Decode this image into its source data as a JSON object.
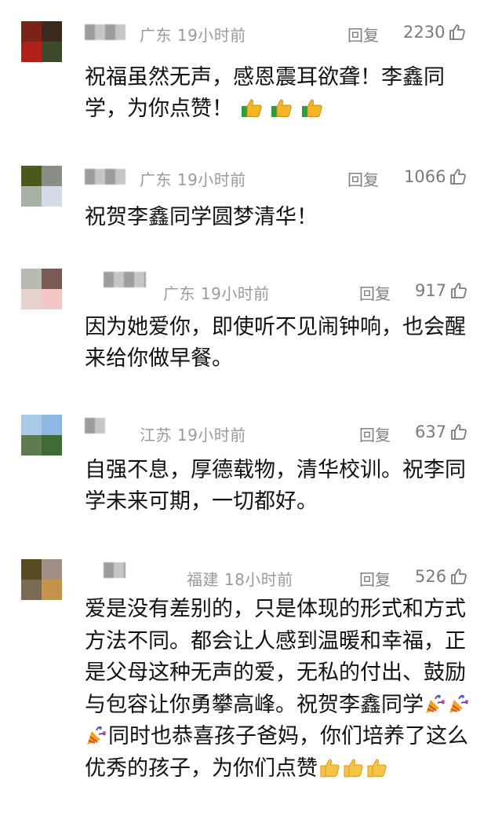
{
  "comments": [
    {
      "location": "广东",
      "time": "19小时前",
      "reply_label": "回复",
      "likes": "2230",
      "avatar_colors": [
        "#7a2418",
        "#3b2a1e",
        "#b01f19",
        "#3c4a2b"
      ],
      "text": "祝福虽然无声，感恩震耳欲聋！李鑫同学，为你点赞！",
      "trailing_icons": [
        "thumbs-up-green-cuff",
        "thumbs-up-green-cuff",
        "thumbs-up-green-cuff"
      ]
    },
    {
      "location": "广东",
      "time": "19小时前",
      "reply_label": "回复",
      "likes": "1066",
      "avatar_colors": [
        "#4a5a1c",
        "#8a8e84",
        "#a8b1a6",
        "#d5dbe6"
      ],
      "text": "祝贺李鑫同学圆梦清华！"
    },
    {
      "location": "广东",
      "time": "19小时前",
      "reply_label": "回复",
      "likes": "917",
      "avatar_colors": [
        "#b9bcb3",
        "#7a5a55",
        "#e6d2cc",
        "#f3c7c3"
      ],
      "text": "因为她爱你，即使听不见闹钟响，也会醒来给你做早餐。"
    },
    {
      "location": "江苏",
      "time": "19小时前",
      "reply_label": "回复",
      "likes": "637",
      "avatar_colors": [
        "#a9c9e9",
        "#8fb7e3",
        "#5f7b52",
        "#3e6a36"
      ],
      "text": "自强不息，厚德载物，清华校训。祝李同学未来可期，一切都好。"
    },
    {
      "location": "福建",
      "time": "18小时前",
      "reply_label": "回复",
      "likes": "526",
      "avatar_colors": [
        "#5a4a22",
        "#9f8f84",
        "#7a6a52",
        "#c2944a"
      ],
      "text_parts": [
        "爱是没有差别的，只是体现的形式和方式方法不同。都会让人感到温暖和幸福，正是父母这种无声的爱，无私的付出、鼓励与包容让你勇攀高峰。祝贺李鑫同学",
        "同时也恭喜孩子爸妈，你们培养了这么优秀的孩子，为你们点赞"
      ],
      "middle_icons": [
        "party-popper",
        "party-popper",
        "party-popper"
      ],
      "trailing_icons": [
        "thumbs-up-yellow",
        "thumbs-up-yellow",
        "thumbs-up-yellow"
      ]
    }
  ]
}
